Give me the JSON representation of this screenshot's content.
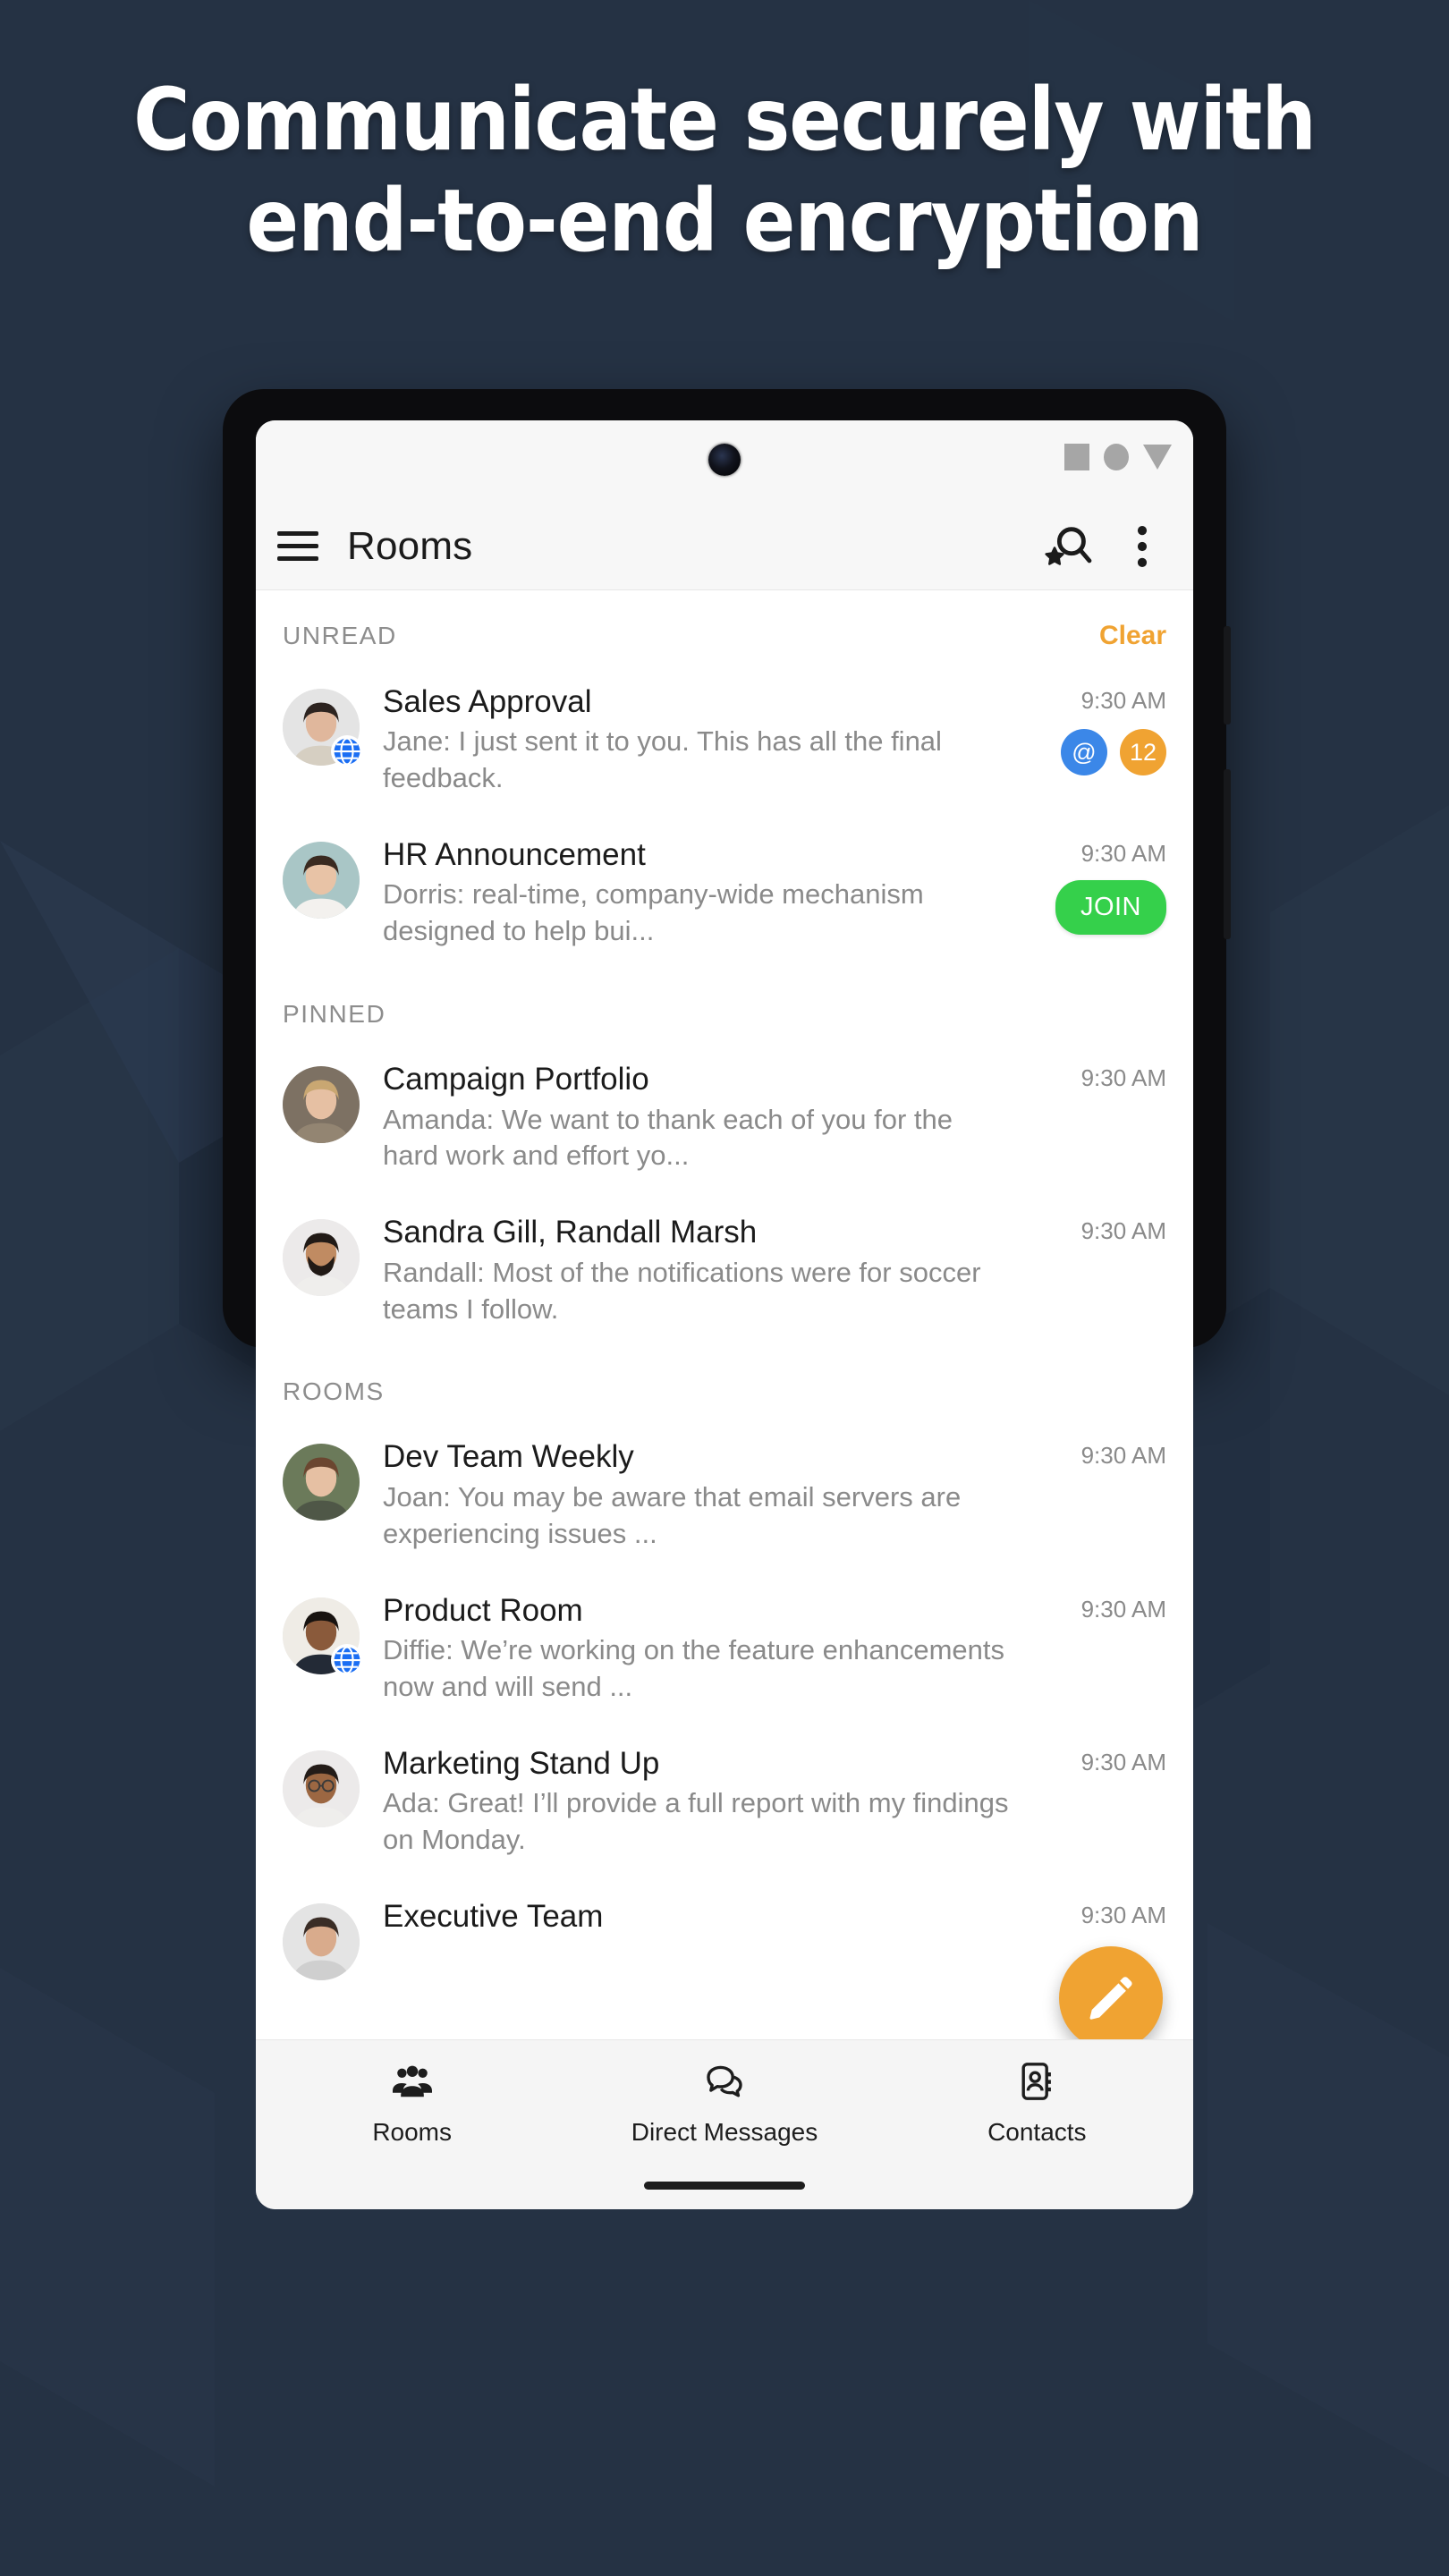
{
  "headline": {
    "line1": "Communicate securely with",
    "line2": "end-to-end encryption"
  },
  "colors": {
    "background": "#253244",
    "accent_orange": "#f0a332",
    "mention_blue": "#3b87e8",
    "join_green": "#35d04b",
    "globe_blue": "#1b6ef3",
    "text_primary": "#1b1b1b",
    "text_secondary": "#8a8a8a"
  },
  "status_bar": {
    "icons": [
      "square-icon",
      "circle-icon",
      "triangle-down-icon"
    ]
  },
  "app_bar": {
    "menu_icon": "hamburger-menu-icon",
    "title": "Rooms",
    "search_icon": "search-star-icon",
    "overflow_icon": "more-vertical-icon"
  },
  "sections": [
    {
      "title": "UNREAD",
      "action": "Clear",
      "rooms": [
        {
          "name": "Sales Approval",
          "preview": "Jane: I just sent it to you. This has all the final feedback.",
          "time": "9:30 AM",
          "avatar": "woman-dark-hair",
          "globe": true,
          "badges": [
            {
              "type": "mention",
              "label": "@"
            },
            {
              "type": "count",
              "label": "12"
            }
          ],
          "join": null
        },
        {
          "name": "HR Announcement",
          "preview": "Dorris: real-time, company-wide mechanism designed to help bui...",
          "time": "9:30 AM",
          "avatar": "woman-long-hair",
          "globe": false,
          "badges": [],
          "join": "JOIN"
        }
      ]
    },
    {
      "title": "PINNED",
      "action": null,
      "rooms": [
        {
          "name": "Campaign Portfolio",
          "preview": "Amanda: We want to thank each of you for the hard work and effort yo...",
          "time": "9:30 AM",
          "avatar": "woman-blonde",
          "globe": false,
          "badges": [],
          "join": null
        },
        {
          "name": "Sandra Gill, Randall Marsh",
          "preview": "Randall: Most of the notifications were for soccer teams I follow.",
          "time": "9:30 AM",
          "avatar": "man-curly-beard",
          "globe": false,
          "badges": [],
          "join": null
        }
      ]
    },
    {
      "title": "ROOMS",
      "action": null,
      "rooms": [
        {
          "name": "Dev Team Weekly",
          "preview": "Joan: You may be aware that email servers are experiencing issues ...",
          "time": "9:30 AM",
          "avatar": "woman-brown-hair",
          "globe": false,
          "badges": [],
          "join": null
        },
        {
          "name": "Product Room",
          "preview": "Diffie: We’re working on the feature enhancements now and will send ...",
          "time": "9:30 AM",
          "avatar": "man-dark-skin-suit",
          "globe": true,
          "badges": [],
          "join": null
        },
        {
          "name": "Marketing Stand Up",
          "preview": "Ada: Great! I’ll provide a full report with my findings on Monday.",
          "time": "9:30 AM",
          "avatar": "woman-glasses-curly",
          "globe": false,
          "badges": [],
          "join": null
        },
        {
          "name": "Executive Team",
          "preview": "",
          "time": "9:30 AM",
          "avatar": "person-generic",
          "globe": false,
          "badges": [],
          "join": null
        }
      ]
    }
  ],
  "fab": {
    "icon": "pencil-edit-icon"
  },
  "bottom_nav": {
    "items": [
      {
        "label": "Rooms",
        "icon": "people-group-icon",
        "active": true
      },
      {
        "label": "Direct Messages",
        "icon": "chat-bubbles-icon",
        "active": false
      },
      {
        "label": "Contacts",
        "icon": "contact-card-icon",
        "active": false
      }
    ]
  }
}
